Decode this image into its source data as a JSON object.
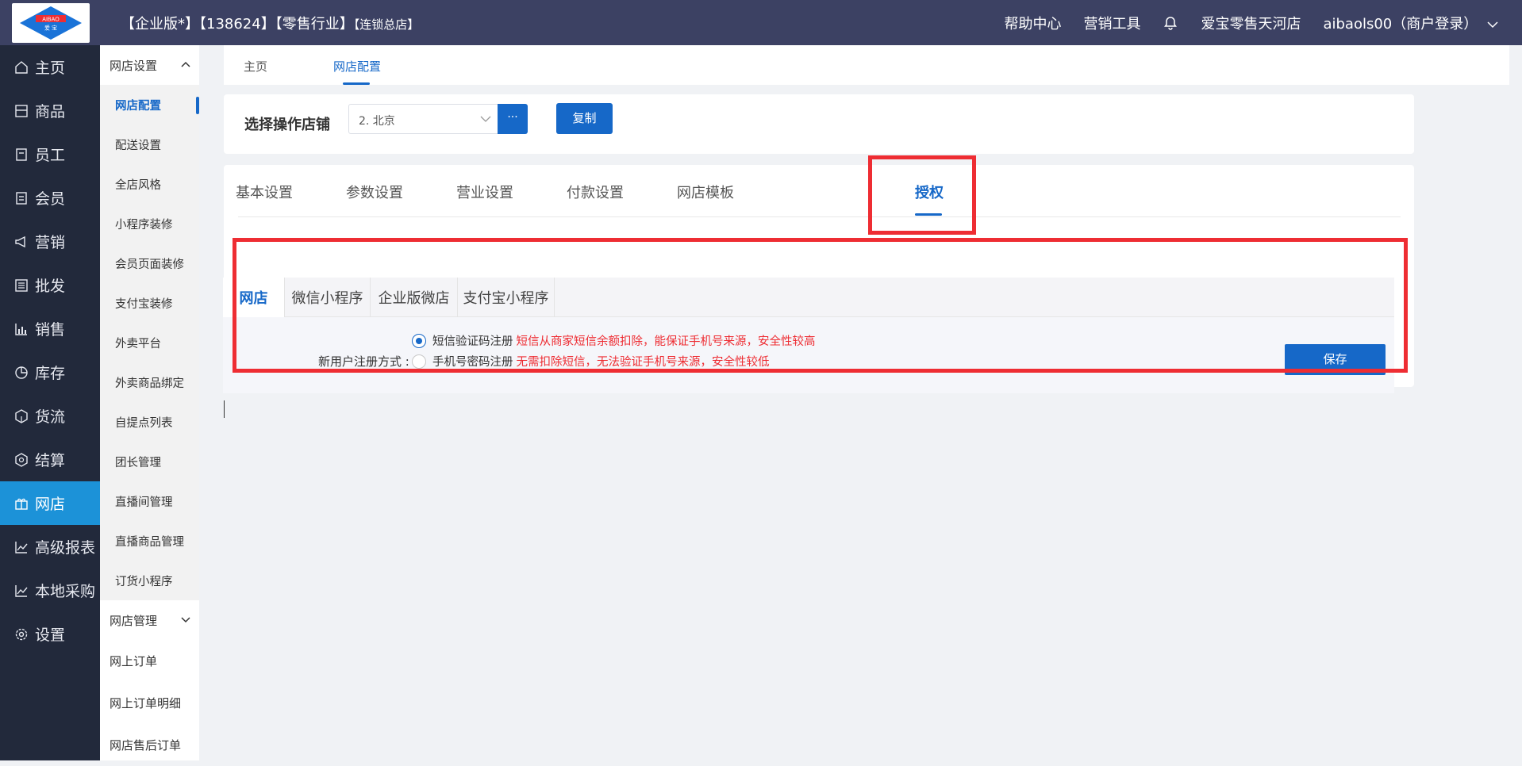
{
  "topbar": {
    "logo_text_top": "AIBAO",
    "logo_text_bottom": "爱  宝",
    "title_main": "【企业版*】【138624】【零售行业】",
    "title_small": "【连锁总店】",
    "help": "帮助中心",
    "tools": "营销工具",
    "store": "爱宝零售天河店",
    "user": "aibaols00（商户登录）"
  },
  "sidebar": {
    "items": [
      {
        "label": "主页",
        "icon": "home-icon"
      },
      {
        "label": "商品",
        "icon": "goods-icon"
      },
      {
        "label": "员工",
        "icon": "staff-icon"
      },
      {
        "label": "会员",
        "icon": "member-icon"
      },
      {
        "label": "营销",
        "icon": "marketing-icon"
      },
      {
        "label": "批发",
        "icon": "wholesale-icon"
      },
      {
        "label": "销售",
        "icon": "sales-icon"
      },
      {
        "label": "库存",
        "icon": "stock-icon"
      },
      {
        "label": "货流",
        "icon": "logistics-icon"
      },
      {
        "label": "结算",
        "icon": "settlement-icon"
      },
      {
        "label": "网店",
        "icon": "shop-icon"
      },
      {
        "label": "高级报表",
        "icon": "report-icon"
      },
      {
        "label": "本地采购",
        "icon": "purchase-icon"
      },
      {
        "label": "设置",
        "icon": "settings-icon"
      }
    ],
    "active": "网店"
  },
  "subnav": {
    "group1": "网店设置",
    "group1_items": [
      "网店配置",
      "配送设置",
      "全店风格",
      "小程序装修",
      "会员页面装修",
      "支付宝装修",
      "外卖平台",
      "外卖商品绑定",
      "自提点列表",
      "团长管理",
      "直播间管理",
      "直播商品管理",
      "订货小程序"
    ],
    "group2": "网店管理",
    "group2_items": [
      "网上订单",
      "网上订单明细",
      "网店售后订单"
    ]
  },
  "pagetabs": {
    "home": "主页",
    "current": "网店配置"
  },
  "store_select": {
    "label": "选择操作店铺",
    "value": "2. 北京",
    "more": "···",
    "copy": "复制"
  },
  "config_tabs": [
    "基本设置",
    "参数设置",
    "营业设置",
    "付款设置",
    "网店模板",
    "授权"
  ],
  "active_config_tab": "授权",
  "auth_tabs": [
    "网店",
    "微信小程序",
    "企业版微店",
    "支付宝小程序"
  ],
  "active_auth_tab": "网店",
  "register": {
    "label": "新用户注册方式 :",
    "option1": "短信验证码注册",
    "option1_note": "短信从商家短信余额扣除，能保证手机号来源，安全性较高",
    "option2": "手机号密码注册",
    "option2_note": "无需扣除短信，无法验证手机号来源，安全性较低",
    "selected": "option1"
  },
  "save_label": "保存",
  "colors": {
    "primary": "#1668c8",
    "highlight": "#ee2d33",
    "topbar": "#3c4163",
    "sidebar": "#22293b",
    "active_nav": "#1c92d8"
  }
}
